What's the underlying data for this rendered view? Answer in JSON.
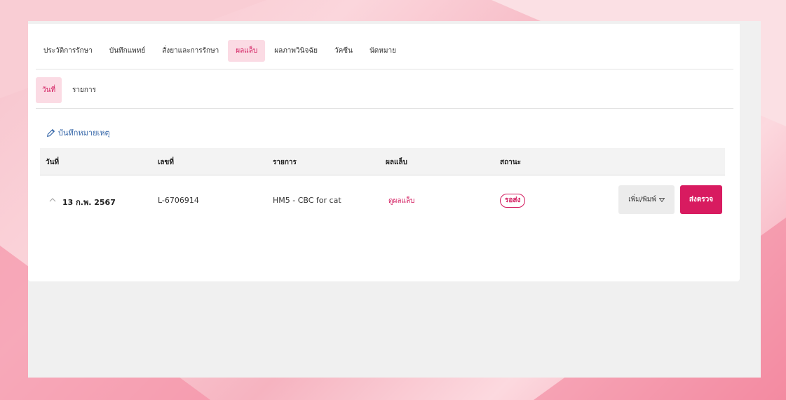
{
  "tabs": [
    {
      "label": "ประวัติการรักษา",
      "active": false
    },
    {
      "label": "บันทึกแพทย์",
      "active": false
    },
    {
      "label": "สั่งยาและการรักษา",
      "active": false
    },
    {
      "label": "ผลแล็บ",
      "active": true
    },
    {
      "label": "ผลภาพวินิจฉัย",
      "active": false
    },
    {
      "label": "วัคซีน",
      "active": false
    },
    {
      "label": "นัดหมาย",
      "active": false
    }
  ],
  "subtabs": [
    {
      "label": "วันที่",
      "active": true
    },
    {
      "label": "รายการ",
      "active": false
    }
  ],
  "note_link": {
    "label": "บันทึกหมายเหตุ",
    "icon": "pencil-icon"
  },
  "table": {
    "columns": [
      "วันที่",
      "เลขที่",
      "รายการ",
      "ผลแล็บ",
      "สถานะ"
    ],
    "rows": [
      {
        "date": "13 ก.พ. 2567",
        "number": "L-6706914",
        "item": "HM5 - CBC for cat",
        "lab_result": "ดูผลแล็บ",
        "status": "รอส่ง",
        "more_label": "เพิ่ม/พิมพ์",
        "send_label": "ส่งตรวจ"
      }
    ]
  },
  "colors": {
    "accent": "#d81b60",
    "link": "#3566a8",
    "active_tab_bg": "#fbdbe4"
  }
}
